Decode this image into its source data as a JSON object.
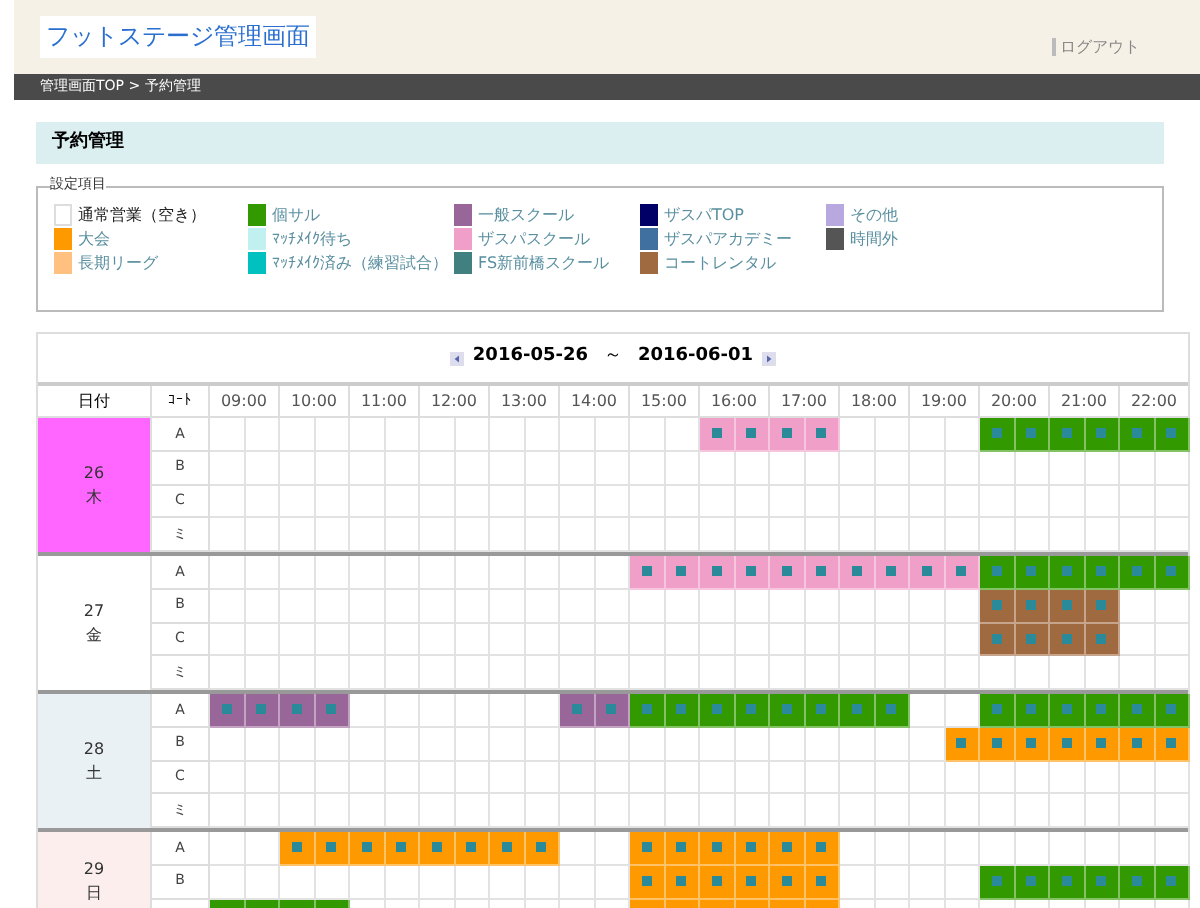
{
  "header": {
    "title": "フットステージ管理画面",
    "logout": "ログアウト"
  },
  "breadcrumb": "管理画面TOP > 予約管理",
  "section_title": "予約管理",
  "legend": {
    "title": "設定項目",
    "items": [
      {
        "label": "通常営業（空き）",
        "color": "#ffffff",
        "selected": true
      },
      {
        "label": "大会",
        "color": "#ff9900",
        "selected": false
      },
      {
        "label": "長期リーグ",
        "color": "#ffc080",
        "selected": false
      },
      {
        "label": "個サル",
        "color": "#339900",
        "selected": false
      },
      {
        "label": "ﾏｯﾁﾒｲｸ待ち",
        "color": "#c0f0f0",
        "selected": false
      },
      {
        "label": "ﾏｯﾁﾒｲｸ済み（練習試合）",
        "color": "#00c0c0",
        "selected": false
      },
      {
        "label": "一般スクール",
        "color": "#996699",
        "selected": false
      },
      {
        "label": "ザスパスクール",
        "color": "#f0a0c8",
        "selected": false
      },
      {
        "label": "FS新前橋スクール",
        "color": "#408080",
        "selected": false
      },
      {
        "label": "ザスパTOP",
        "color": "#000066",
        "selected": false
      },
      {
        "label": "ザスパアカデミー",
        "color": "#4070a0",
        "selected": false
      },
      {
        "label": "コートレンタル",
        "color": "#a06a40",
        "selected": false
      },
      {
        "label": "その他",
        "color": "#b8a8e0",
        "selected": false
      },
      {
        "label": "時間外",
        "color": "#555555",
        "selected": false
      }
    ]
  },
  "table": {
    "range_start": "2016-05-26",
    "range_sep": "～",
    "range_end": "2016-06-01",
    "date_heading": "日付",
    "court_heading": "ｺｰﾄ",
    "hours": [
      "09:00",
      "10:00",
      "11:00",
      "12:00",
      "13:00",
      "14:00",
      "15:00",
      "16:00",
      "17:00",
      "18:00",
      "19:00",
      "20:00",
      "21:00",
      "22:00"
    ],
    "days": [
      {
        "day": "26",
        "weekday": "木",
        "kind": "highlight",
        "courts": [
          {
            "label": "A",
            "cells": [
              {
                "booked": false
              },
              {
                "booked": false
              },
              {
                "booked": false
              },
              {
                "booked": false
              },
              {
                "booked": false
              },
              {
                "booked": false
              },
              {
                "booked": false
              },
              {
                "booked": false
              },
              {
                "booked": false
              },
              {
                "booked": false
              },
              {
                "booked": false
              },
              {
                "booked": false
              },
              {
                "booked": false
              },
              {
                "booked": false
              },
              {
                "booked": true,
                "color": "#f0a0c8"
              },
              {
                "booked": true,
                "color": "#f0a0c8"
              },
              {
                "booked": true,
                "color": "#f0a0c8"
              },
              {
                "booked": true,
                "color": "#f0a0c8"
              },
              {
                "booked": false
              },
              {
                "booked": false
              },
              {
                "booked": false
              },
              {
                "booked": false
              },
              {
                "booked": true,
                "color": "#339900"
              },
              {
                "booked": true,
                "color": "#339900"
              },
              {
                "booked": true,
                "color": "#339900"
              },
              {
                "booked": true,
                "color": "#339900"
              },
              {
                "booked": true,
                "color": "#339900"
              },
              {
                "booked": true,
                "color": "#339900"
              }
            ]
          },
          {
            "label": "B",
            "cells": [
              {
                "booked": false
              },
              {
                "booked": false
              },
              {
                "booked": false
              },
              {
                "booked": false
              },
              {
                "booked": false
              },
              {
                "booked": false
              },
              {
                "booked": false
              },
              {
                "booked": false
              },
              {
                "booked": false
              },
              {
                "booked": false
              },
              {
                "booked": false
              },
              {
                "booked": false
              },
              {
                "booked": false
              },
              {
                "booked": false
              },
              {
                "booked": false
              },
              {
                "booked": false
              },
              {
                "booked": false
              },
              {
                "booked": false
              },
              {
                "booked": false
              },
              {
                "booked": false
              },
              {
                "booked": false
              },
              {
                "booked": false
              },
              {
                "booked": false
              },
              {
                "booked": false
              },
              {
                "booked": false
              },
              {
                "booked": false
              },
              {
                "booked": false
              },
              {
                "booked": false
              }
            ]
          },
          {
            "label": "C",
            "cells": [
              {
                "booked": false
              },
              {
                "booked": false
              },
              {
                "booked": false
              },
              {
                "booked": false
              },
              {
                "booked": false
              },
              {
                "booked": false
              },
              {
                "booked": false
              },
              {
                "booked": false
              },
              {
                "booked": false
              },
              {
                "booked": false
              },
              {
                "booked": false
              },
              {
                "booked": false
              },
              {
                "booked": false
              },
              {
                "booked": false
              },
              {
                "booked": false
              },
              {
                "booked": false
              },
              {
                "booked": false
              },
              {
                "booked": false
              },
              {
                "booked": false
              },
              {
                "booked": false
              },
              {
                "booked": false
              },
              {
                "booked": false
              },
              {
                "booked": false
              },
              {
                "booked": false
              },
              {
                "booked": false
              },
              {
                "booked": false
              },
              {
                "booked": false
              },
              {
                "booked": false
              }
            ]
          },
          {
            "label": "ミ",
            "cells": [
              {
                "booked": false
              },
              {
                "booked": false
              },
              {
                "booked": false
              },
              {
                "booked": false
              },
              {
                "booked": false
              },
              {
                "booked": false
              },
              {
                "booked": false
              },
              {
                "booked": false
              },
              {
                "booked": false
              },
              {
                "booked": false
              },
              {
                "booked": false
              },
              {
                "booked": false
              },
              {
                "booked": false
              },
              {
                "booked": false
              },
              {
                "booked": false
              },
              {
                "booked": false
              },
              {
                "booked": false
              },
              {
                "booked": false
              },
              {
                "booked": false
              },
              {
                "booked": false
              },
              {
                "booked": false
              },
              {
                "booked": false
              },
              {
                "booked": false
              },
              {
                "booked": false
              },
              {
                "booked": false
              },
              {
                "booked": false
              },
              {
                "booked": false
              },
              {
                "booked": false
              }
            ]
          }
        ]
      },
      {
        "day": "27",
        "weekday": "金",
        "kind": "weekday",
        "courts": [
          {
            "label": "A",
            "cells": [
              {
                "booked": false
              },
              {
                "booked": false
              },
              {
                "booked": false
              },
              {
                "booked": false
              },
              {
                "booked": false
              },
              {
                "booked": false
              },
              {
                "booked": false
              },
              {
                "booked": false
              },
              {
                "booked": false
              },
              {
                "booked": false
              },
              {
                "booked": false
              },
              {
                "booked": false
              },
              {
                "booked": true,
                "color": "#f0a0c8"
              },
              {
                "booked": true,
                "color": "#f0a0c8"
              },
              {
                "booked": true,
                "color": "#f0a0c8"
              },
              {
                "booked": true,
                "color": "#f0a0c8"
              },
              {
                "booked": true,
                "color": "#f0a0c8"
              },
              {
                "booked": true,
                "color": "#f0a0c8"
              },
              {
                "booked": true,
                "color": "#f0a0c8"
              },
              {
                "booked": true,
                "color": "#f0a0c8"
              },
              {
                "booked": true,
                "color": "#f0a0c8"
              },
              {
                "booked": true,
                "color": "#f0a0c8"
              },
              {
                "booked": true,
                "color": "#339900"
              },
              {
                "booked": true,
                "color": "#339900"
              },
              {
                "booked": true,
                "color": "#339900"
              },
              {
                "booked": true,
                "color": "#339900"
              },
              {
                "booked": true,
                "color": "#339900"
              },
              {
                "booked": true,
                "color": "#339900"
              }
            ]
          },
          {
            "label": "B",
            "cells": [
              {
                "booked": false
              },
              {
                "booked": false
              },
              {
                "booked": false
              },
              {
                "booked": false
              },
              {
                "booked": false
              },
              {
                "booked": false
              },
              {
                "booked": false
              },
              {
                "booked": false
              },
              {
                "booked": false
              },
              {
                "booked": false
              },
              {
                "booked": false
              },
              {
                "booked": false
              },
              {
                "booked": false
              },
              {
                "booked": false
              },
              {
                "booked": false
              },
              {
                "booked": false
              },
              {
                "booked": false
              },
              {
                "booked": false
              },
              {
                "booked": false
              },
              {
                "booked": false
              },
              {
                "booked": false
              },
              {
                "booked": false
              },
              {
                "booked": true,
                "color": "#a06a40"
              },
              {
                "booked": true,
                "color": "#a06a40"
              },
              {
                "booked": true,
                "color": "#a06a40"
              },
              {
                "booked": true,
                "color": "#a06a40"
              },
              {
                "booked": false
              },
              {
                "booked": false
              }
            ]
          },
          {
            "label": "C",
            "cells": [
              {
                "booked": false
              },
              {
                "booked": false
              },
              {
                "booked": false
              },
              {
                "booked": false
              },
              {
                "booked": false
              },
              {
                "booked": false
              },
              {
                "booked": false
              },
              {
                "booked": false
              },
              {
                "booked": false
              },
              {
                "booked": false
              },
              {
                "booked": false
              },
              {
                "booked": false
              },
              {
                "booked": false
              },
              {
                "booked": false
              },
              {
                "booked": false
              },
              {
                "booked": false
              },
              {
                "booked": false
              },
              {
                "booked": false
              },
              {
                "booked": false
              },
              {
                "booked": false
              },
              {
                "booked": false
              },
              {
                "booked": false
              },
              {
                "booked": true,
                "color": "#a06a40"
              },
              {
                "booked": true,
                "color": "#a06a40"
              },
              {
                "booked": true,
                "color": "#a06a40"
              },
              {
                "booked": true,
                "color": "#a06a40"
              },
              {
                "booked": false
              },
              {
                "booked": false
              }
            ]
          },
          {
            "label": "ミ",
            "cells": [
              {
                "booked": false
              },
              {
                "booked": false
              },
              {
                "booked": false
              },
              {
                "booked": false
              },
              {
                "booked": false
              },
              {
                "booked": false
              },
              {
                "booked": false
              },
              {
                "booked": false
              },
              {
                "booked": false
              },
              {
                "booked": false
              },
              {
                "booked": false
              },
              {
                "booked": false
              },
              {
                "booked": false
              },
              {
                "booked": false
              },
              {
                "booked": false
              },
              {
                "booked": false
              },
              {
                "booked": false
              },
              {
                "booked": false
              },
              {
                "booked": false
              },
              {
                "booked": false
              },
              {
                "booked": false
              },
              {
                "booked": false
              },
              {
                "booked": false
              },
              {
                "booked": false
              },
              {
                "booked": false
              },
              {
                "booked": false
              },
              {
                "booked": false
              },
              {
                "booked": false
              }
            ]
          }
        ]
      },
      {
        "day": "28",
        "weekday": "土",
        "kind": "saturday",
        "courts": [
          {
            "label": "A",
            "cells": [
              {
                "booked": true,
                "color": "#996699"
              },
              {
                "booked": true,
                "color": "#996699"
              },
              {
                "booked": true,
                "color": "#996699"
              },
              {
                "booked": true,
                "color": "#996699"
              },
              {
                "booked": false
              },
              {
                "booked": false
              },
              {
                "booked": false
              },
              {
                "booked": false
              },
              {
                "booked": false
              },
              {
                "booked": false
              },
              {
                "booked": true,
                "color": "#996699"
              },
              {
                "booked": true,
                "color": "#996699"
              },
              {
                "booked": true,
                "color": "#339900"
              },
              {
                "booked": true,
                "color": "#339900"
              },
              {
                "booked": true,
                "color": "#339900"
              },
              {
                "booked": true,
                "color": "#339900"
              },
              {
                "booked": true,
                "color": "#339900"
              },
              {
                "booked": true,
                "color": "#339900"
              },
              {
                "booked": true,
                "color": "#339900"
              },
              {
                "booked": true,
                "color": "#339900"
              },
              {
                "booked": false
              },
              {
                "booked": false
              },
              {
                "booked": true,
                "color": "#339900"
              },
              {
                "booked": true,
                "color": "#339900"
              },
              {
                "booked": true,
                "color": "#339900"
              },
              {
                "booked": true,
                "color": "#339900"
              },
              {
                "booked": true,
                "color": "#339900"
              },
              {
                "booked": true,
                "color": "#339900"
              }
            ]
          },
          {
            "label": "B",
            "cells": [
              {
                "booked": false
              },
              {
                "booked": false
              },
              {
                "booked": false
              },
              {
                "booked": false
              },
              {
                "booked": false
              },
              {
                "booked": false
              },
              {
                "booked": false
              },
              {
                "booked": false
              },
              {
                "booked": false
              },
              {
                "booked": false
              },
              {
                "booked": false
              },
              {
                "booked": false
              },
              {
                "booked": false
              },
              {
                "booked": false
              },
              {
                "booked": false
              },
              {
                "booked": false
              },
              {
                "booked": false
              },
              {
                "booked": false
              },
              {
                "booked": false
              },
              {
                "booked": false
              },
              {
                "booked": false
              },
              {
                "booked": true,
                "color": "#ff9900"
              },
              {
                "booked": true,
                "color": "#ff9900"
              },
              {
                "booked": true,
                "color": "#ff9900"
              },
              {
                "booked": true,
                "color": "#ff9900"
              },
              {
                "booked": true,
                "color": "#ff9900"
              },
              {
                "booked": true,
                "color": "#ff9900"
              },
              {
                "booked": true,
                "color": "#ff9900"
              }
            ]
          },
          {
            "label": "C",
            "cells": [
              {
                "booked": false
              },
              {
                "booked": false
              },
              {
                "booked": false
              },
              {
                "booked": false
              },
              {
                "booked": false
              },
              {
                "booked": false
              },
              {
                "booked": false
              },
              {
                "booked": false
              },
              {
                "booked": false
              },
              {
                "booked": false
              },
              {
                "booked": false
              },
              {
                "booked": false
              },
              {
                "booked": false
              },
              {
                "booked": false
              },
              {
                "booked": false
              },
              {
                "booked": false
              },
              {
                "booked": false
              },
              {
                "booked": false
              },
              {
                "booked": false
              },
              {
                "booked": false
              },
              {
                "booked": false
              },
              {
                "booked": false
              },
              {
                "booked": false
              },
              {
                "booked": false
              },
              {
                "booked": false
              },
              {
                "booked": false
              },
              {
                "booked": false
              },
              {
                "booked": false
              }
            ]
          },
          {
            "label": "ミ",
            "cells": [
              {
                "booked": false
              },
              {
                "booked": false
              },
              {
                "booked": false
              },
              {
                "booked": false
              },
              {
                "booked": false
              },
              {
                "booked": false
              },
              {
                "booked": false
              },
              {
                "booked": false
              },
              {
                "booked": false
              },
              {
                "booked": false
              },
              {
                "booked": false
              },
              {
                "booked": false
              },
              {
                "booked": false
              },
              {
                "booked": false
              },
              {
                "booked": false
              },
              {
                "booked": false
              },
              {
                "booked": false
              },
              {
                "booked": false
              },
              {
                "booked": false
              },
              {
                "booked": false
              },
              {
                "booked": false
              },
              {
                "booked": false
              },
              {
                "booked": false
              },
              {
                "booked": false
              },
              {
                "booked": false
              },
              {
                "booked": false
              },
              {
                "booked": false
              },
              {
                "booked": false
              }
            ]
          }
        ]
      },
      {
        "day": "29",
        "weekday": "日",
        "kind": "sunday",
        "courts": [
          {
            "label": "A",
            "cells": [
              {
                "booked": false
              },
              {
                "booked": false
              },
              {
                "booked": true,
                "color": "#ff9900"
              },
              {
                "booked": true,
                "color": "#ff9900"
              },
              {
                "booked": true,
                "color": "#ff9900"
              },
              {
                "booked": true,
                "color": "#ff9900"
              },
              {
                "booked": true,
                "color": "#ff9900"
              },
              {
                "booked": true,
                "color": "#ff9900"
              },
              {
                "booked": true,
                "color": "#ff9900"
              },
              {
                "booked": true,
                "color": "#ff9900"
              },
              {
                "booked": false
              },
              {
                "booked": false
              },
              {
                "booked": true,
                "color": "#ff9900"
              },
              {
                "booked": true,
                "color": "#ff9900"
              },
              {
                "booked": true,
                "color": "#ff9900"
              },
              {
                "booked": true,
                "color": "#ff9900"
              },
              {
                "booked": true,
                "color": "#ff9900"
              },
              {
                "booked": true,
                "color": "#ff9900"
              },
              {
                "booked": false
              },
              {
                "booked": false
              },
              {
                "booked": false
              },
              {
                "booked": false
              },
              {
                "booked": false
              },
              {
                "booked": false
              },
              {
                "booked": false
              },
              {
                "booked": false
              },
              {
                "booked": false
              },
              {
                "booked": false
              }
            ]
          },
          {
            "label": "B",
            "cells": [
              {
                "booked": false
              },
              {
                "booked": false
              },
              {
                "booked": false
              },
              {
                "booked": false
              },
              {
                "booked": false
              },
              {
                "booked": false
              },
              {
                "booked": false
              },
              {
                "booked": false
              },
              {
                "booked": false
              },
              {
                "booked": false
              },
              {
                "booked": false
              },
              {
                "booked": false
              },
              {
                "booked": true,
                "color": "#ff9900"
              },
              {
                "booked": true,
                "color": "#ff9900"
              },
              {
                "booked": true,
                "color": "#ff9900"
              },
              {
                "booked": true,
                "color": "#ff9900"
              },
              {
                "booked": true,
                "color": "#ff9900"
              },
              {
                "booked": true,
                "color": "#ff9900"
              },
              {
                "booked": false
              },
              {
                "booked": false
              },
              {
                "booked": false
              },
              {
                "booked": false
              },
              {
                "booked": true,
                "color": "#339900"
              },
              {
                "booked": true,
                "color": "#339900"
              },
              {
                "booked": true,
                "color": "#339900"
              },
              {
                "booked": true,
                "color": "#339900"
              },
              {
                "booked": true,
                "color": "#339900"
              },
              {
                "booked": true,
                "color": "#339900"
              }
            ]
          },
          {
            "cells": [
              {
                "booked": true,
                "color": "#339900"
              },
              {
                "booked": true,
                "color": "#339900"
              },
              {
                "booked": true,
                "color": "#339900"
              },
              {
                "booked": true,
                "color": "#339900"
              },
              {
                "booked": false
              },
              {
                "booked": false
              },
              {
                "booked": false
              },
              {
                "booked": false
              },
              {
                "booked": false
              },
              {
                "booked": false
              },
              {
                "booked": false
              },
              {
                "booked": false
              },
              {
                "booked": true,
                "color": "#ff9900"
              },
              {
                "booked": true,
                "color": "#ff9900"
              },
              {
                "booked": true,
                "color": "#ff9900"
              },
              {
                "booked": true,
                "color": "#ff9900"
              },
              {
                "booked": true,
                "color": "#ff9900"
              },
              {
                "booked": true,
                "color": "#ff9900"
              },
              {
                "booked": false
              },
              {
                "booked": false
              },
              {
                "booked": false
              },
              {
                "booked": false
              },
              {
                "booked": false
              },
              {
                "booked": false
              },
              {
                "booked": false
              },
              {
                "booked": false
              },
              {
                "booked": false
              },
              {
                "booked": false
              }
            ]
          }
        ]
      }
    ]
  }
}
